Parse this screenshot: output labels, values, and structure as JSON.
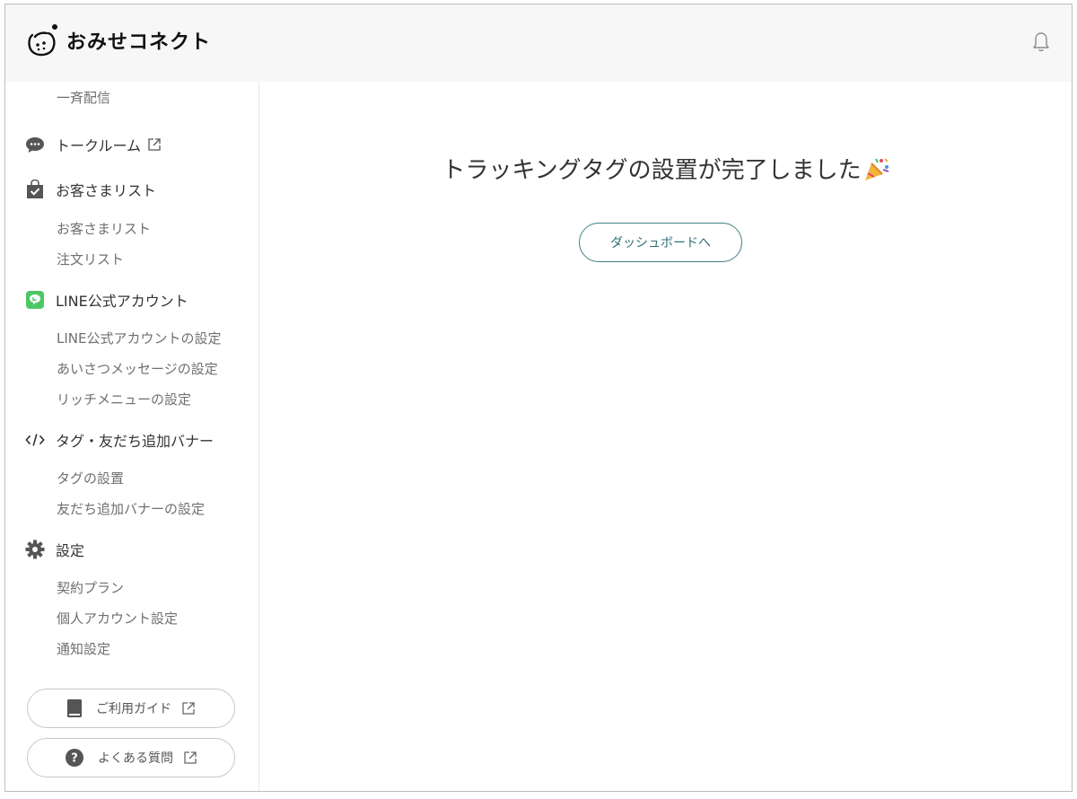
{
  "header": {
    "brand": "おみせコネクト",
    "bell_icon": "bell-icon"
  },
  "sidebar": {
    "top_item": "一斉配信",
    "talkroom": {
      "label": "トークルーム",
      "icon": "chat-bubble-icon"
    },
    "customers": {
      "label": "お客さまリスト",
      "icon": "shopping-bag-check-icon",
      "items": [
        "お客さまリスト",
        "注文リスト"
      ]
    },
    "line": {
      "label": "LINE公式アカウント",
      "icon": "line-badge-icon",
      "items": [
        "LINE公式アカウントの設定",
        "あいさつメッセージの設定",
        "リッチメニューの設定"
      ]
    },
    "tags": {
      "label": "タグ・友だち追加バナー",
      "icon": "code-icon",
      "items": [
        "タグの設置",
        "友だち追加バナーの設定"
      ]
    },
    "settings": {
      "label": "設定",
      "icon": "gear-icon",
      "items": [
        "契約プラン",
        "個人アカウント設定",
        "通知設定"
      ]
    },
    "guide_button": "ご利用ガイド",
    "faq_button": "よくある質問"
  },
  "main": {
    "title": "トラッキングタグの設置が完了しました",
    "title_emoji": "party-popper-icon",
    "dashboard_button": "ダッシュボードへ"
  },
  "colors": {
    "accent": "#2f6f74",
    "line_green": "#4cc764",
    "header_bg": "#f7f7f7",
    "icon_gray": "#555555"
  }
}
